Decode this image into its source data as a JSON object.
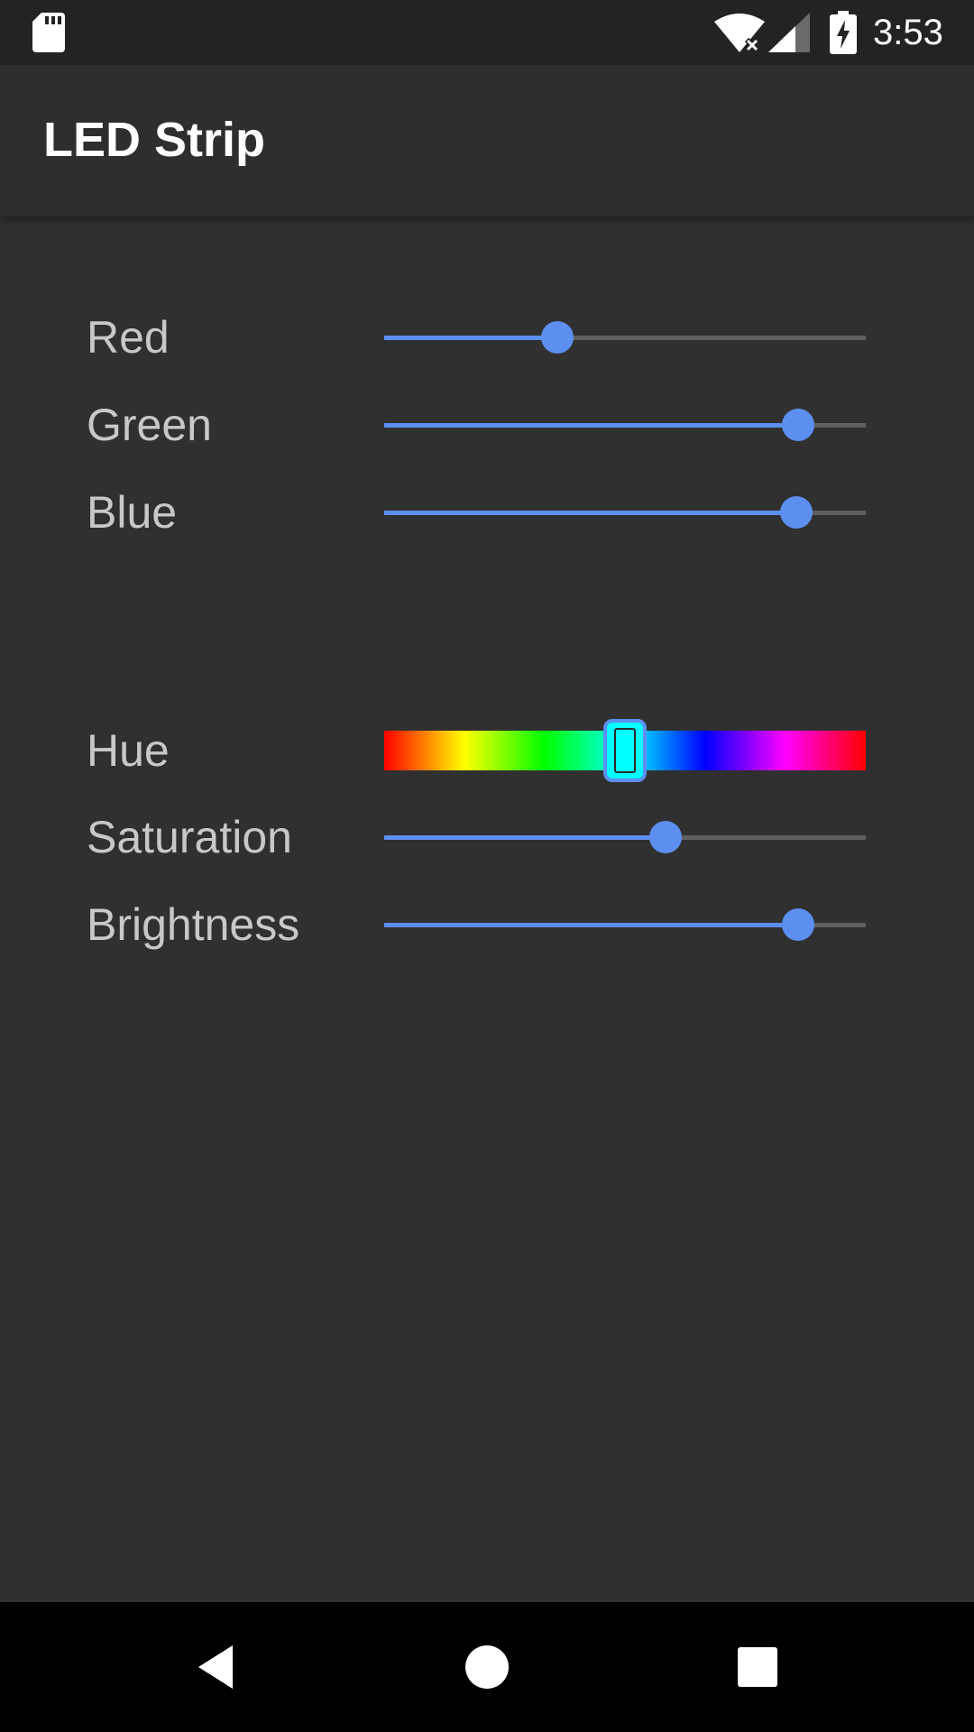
{
  "status_bar": {
    "time": "3:53",
    "icons": [
      "sd-card-icon",
      "wifi-icon",
      "signal-icon",
      "battery-charging-icon"
    ]
  },
  "app_bar": {
    "title": "LED Strip"
  },
  "rgb_sliders": [
    {
      "label": "Red",
      "value_fraction": 0.36
    },
    {
      "label": "Green",
      "value_fraction": 0.86
    },
    {
      "label": "Blue",
      "value_fraction": 0.855
    }
  ],
  "hsb_sliders": {
    "hue": {
      "label": "Hue",
      "value_fraction": 0.5
    },
    "saturation": {
      "label": "Saturation",
      "value_fraction": 0.585
    },
    "brightness": {
      "label": "Brightness",
      "value_fraction": 0.86
    }
  },
  "colors": {
    "accent": "#5c8ff0",
    "background": "#303030",
    "app_bar": "#2e2e2e",
    "track": "#5f5f5f",
    "label_text": "#c8c8c8"
  },
  "nav_bar": {
    "icons": [
      "back-icon",
      "home-icon",
      "recents-icon"
    ]
  }
}
